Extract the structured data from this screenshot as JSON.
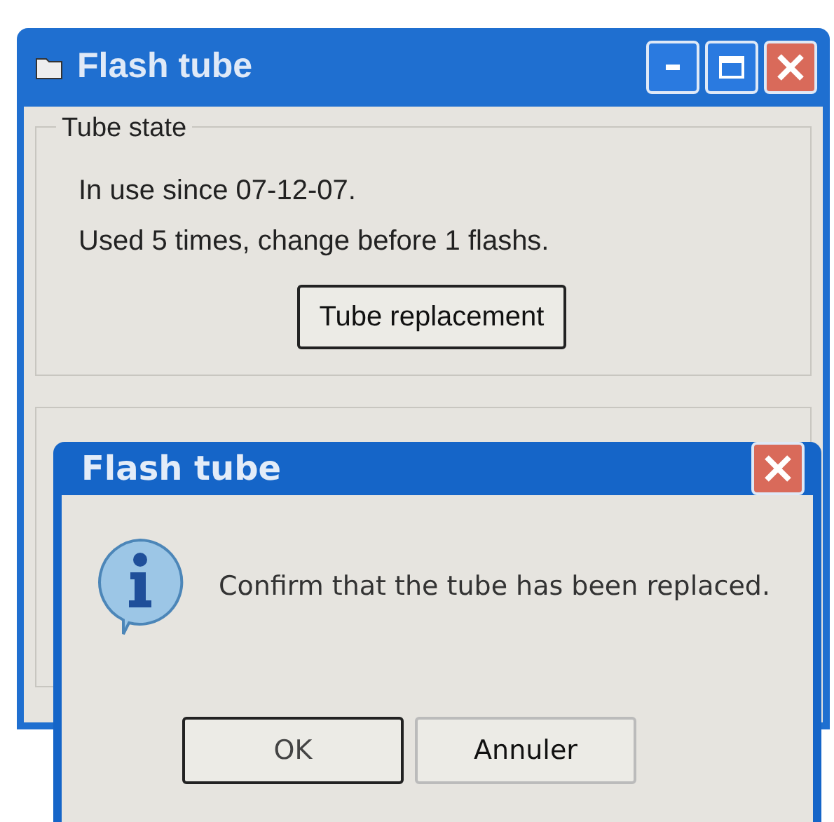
{
  "window": {
    "title": "Flash tube"
  },
  "tube_state": {
    "title": "Tube state",
    "lines": [
      "In use since 07-12-07.",
      "Used 5 times, change before 1 flashs."
    ],
    "button": "Tube replacement"
  },
  "dialog": {
    "title": "Flash tube",
    "message": "Confirm that the tube has been replaced.",
    "buttons": [
      {
        "label": "OK",
        "default": true
      },
      {
        "label": "Annuler",
        "default": false
      }
    ]
  }
}
